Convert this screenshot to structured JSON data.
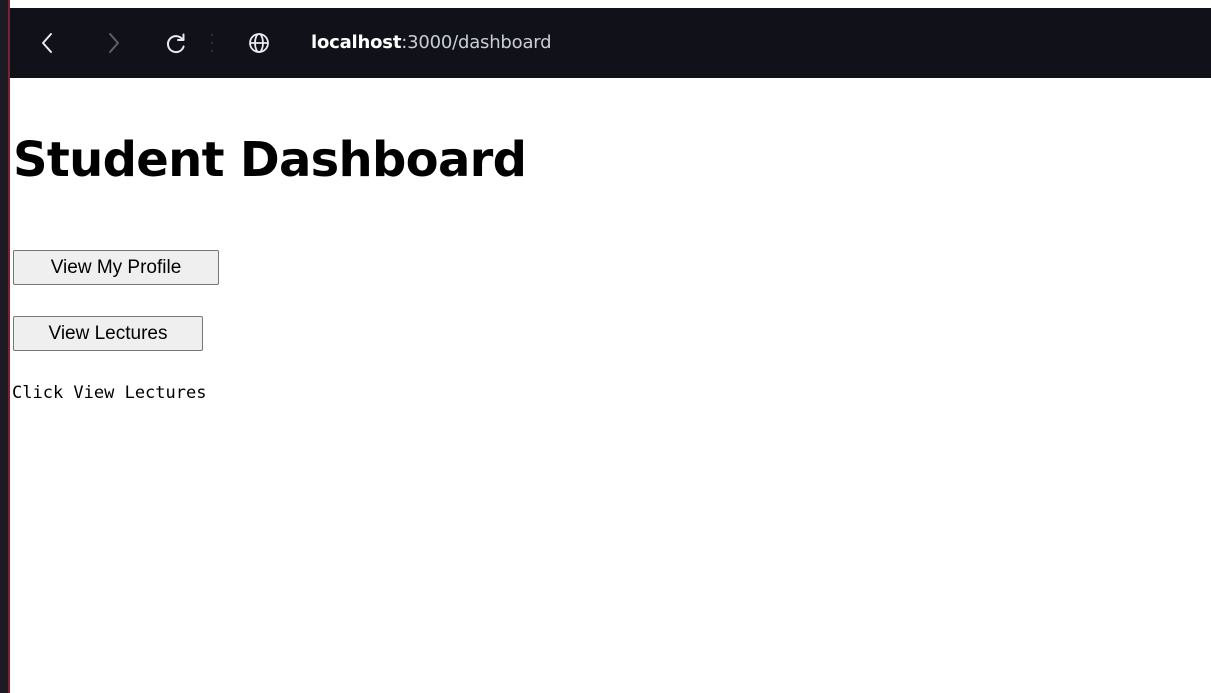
{
  "browser": {
    "url_host": "localhost",
    "url_path": ":3000/dashboard",
    "icons": [
      "back-icon",
      "forward-icon",
      "reload-icon",
      "globe-icon"
    ],
    "colors": {
      "toolbar_background": "#11111a",
      "url_host_text": "#ffffff",
      "url_path_text": "#c9ced6"
    }
  },
  "page": {
    "title": "Student Dashboard",
    "buttons": {
      "profile_label": "View My Profile",
      "lectures_label": "View Lectures"
    },
    "status_message": "Click View Lectures"
  }
}
